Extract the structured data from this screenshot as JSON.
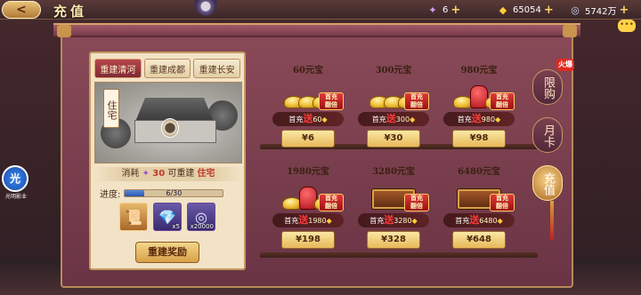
{
  "header": {
    "back_label": "<",
    "title": "充值",
    "resources": [
      {
        "icon": "token-icon",
        "glyph": "✦",
        "value": "6"
      },
      {
        "icon": "gold-ingot-icon",
        "glyph": "◆",
        "value": "65054"
      },
      {
        "icon": "coin-icon",
        "glyph": "◎",
        "value": "5742万"
      }
    ],
    "plus_label": "+",
    "chat_label": "•••"
  },
  "left_panel": {
    "tabs": [
      "重建清河",
      "重建成都",
      "重建长安"
    ],
    "active_tab": 0,
    "building_label": "住宅",
    "cost": {
      "prefix": "消耗",
      "amount": "30",
      "middle": "可重建",
      "target": "住宅"
    },
    "progress": {
      "label": "进度:",
      "text": "6/30",
      "fraction": 0.2
    },
    "rewards": [
      {
        "icon": "scroll-icon",
        "glyph": "📜",
        "count": ""
      },
      {
        "icon": "blue-crystal-icon",
        "glyph": "💎",
        "count": "x5"
      },
      {
        "icon": "silver-coin-icon",
        "glyph": "◎",
        "count": "x20000"
      }
    ],
    "rebuild_button": "重建奖励"
  },
  "products": [
    {
      "label": "60元宝",
      "badge": "首充\n翻倍",
      "bonus_prefix": "首充",
      "song": "送",
      "bonus_amount": "60",
      "price": "¥6",
      "art": "ingots"
    },
    {
      "label": "300元宝",
      "badge": "首充\n翻倍",
      "bonus_prefix": "首充",
      "song": "送",
      "bonus_amount": "300",
      "price": "¥30",
      "art": "ingots"
    },
    {
      "label": "980元宝",
      "badge": "首充\n翻倍",
      "bonus_prefix": "首充",
      "song": "送",
      "bonus_amount": "980",
      "price": "¥98",
      "art": "redbag"
    },
    {
      "label": "1980元宝",
      "badge": "首充\n翻倍",
      "bonus_prefix": "首充",
      "song": "送",
      "bonus_amount": "1980",
      "price": "¥198",
      "art": "redbag"
    },
    {
      "label": "3280元宝",
      "badge": "首充\n翻倍",
      "bonus_prefix": "首充",
      "song": "送",
      "bonus_amount": "3280",
      "price": "¥328",
      "art": "chest"
    },
    {
      "label": "6480元宝",
      "badge": "首充\n翻倍",
      "bonus_prefix": "首充",
      "song": "送",
      "bonus_amount": "6480",
      "price": "¥648",
      "art": "chest"
    }
  ],
  "side_tabs": [
    "限购",
    "月卡",
    "充值"
  ],
  "active_side_tab": 2,
  "hot_badge": "火爆",
  "float_button": {
    "label": "光",
    "sub": "光明影业"
  }
}
